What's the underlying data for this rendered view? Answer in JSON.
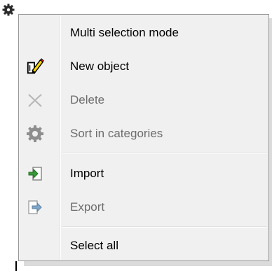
{
  "menu": {
    "items": [
      {
        "label": "Multi selection mode",
        "icon": "none",
        "enabled": true
      },
      {
        "label": "New object",
        "icon": "pencil-document-icon",
        "enabled": true
      },
      {
        "label": "Delete",
        "icon": "delete-x-icon",
        "enabled": false
      },
      {
        "label": "Sort in categories",
        "icon": "gear-icon",
        "enabled": false
      },
      {
        "label": "Import",
        "icon": "import-arrow-icon",
        "enabled": true
      },
      {
        "label": "Export",
        "icon": "export-arrow-icon",
        "enabled": false
      },
      {
        "label": "Select all",
        "icon": "none",
        "enabled": true
      }
    ]
  },
  "colors": {
    "menu_background": "#f0f0f0",
    "menu_border": "#979797",
    "disabled_text": "#6d6d6d",
    "enabled_text": "#000000",
    "import_arrow": "#3a9a3a",
    "pencil": "#f5d400"
  }
}
